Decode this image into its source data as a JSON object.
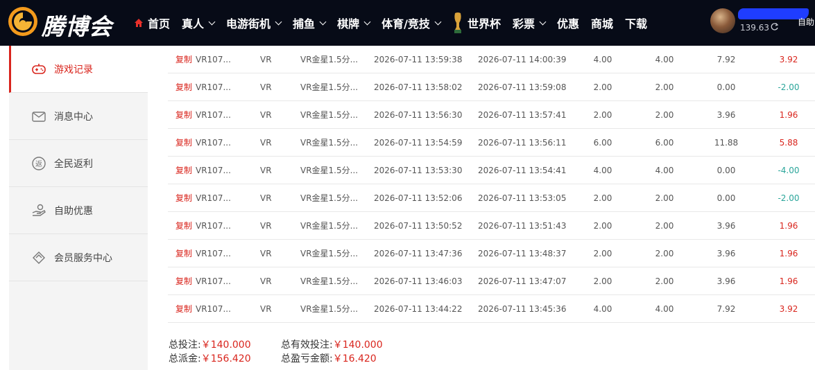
{
  "brand": {
    "name": "腾博会"
  },
  "nav": {
    "items": [
      {
        "label": "首页"
      },
      {
        "label": "真人"
      },
      {
        "label": "电游街机"
      },
      {
        "label": "捕鱼"
      },
      {
        "label": "棋牌"
      },
      {
        "label": "体育/竞技"
      },
      {
        "label": "世界杯"
      },
      {
        "label": "彩票"
      },
      {
        "label": "优惠"
      },
      {
        "label": "商城"
      },
      {
        "label": "下载"
      }
    ]
  },
  "user": {
    "balance": "139.63",
    "auto_label": "自助"
  },
  "sidebar": {
    "items": [
      {
        "label": "游戏记录",
        "icon": "gamepad-icon",
        "active": true
      },
      {
        "label": "消息中心",
        "icon": "mail-icon"
      },
      {
        "label": "全民返利",
        "icon": "rebate-icon"
      },
      {
        "label": "自助优惠",
        "icon": "hand-coin-icon"
      },
      {
        "label": "会员服务中心",
        "icon": "diamond-icon"
      }
    ]
  },
  "table": {
    "copy_label": "复制",
    "rows": [
      {
        "id": "VR107...",
        "platform": "VR",
        "game": "VR金星1.5分...",
        "bet_time": "2026-07-11 13:59:38",
        "settle_time": "2026-07-11 14:00:39",
        "bet": "4.00",
        "valid": "4.00",
        "payout": "7.92",
        "profit": "3.92",
        "sign": "pos"
      },
      {
        "id": "VR107...",
        "platform": "VR",
        "game": "VR金星1.5分...",
        "bet_time": "2026-07-11 13:58:02",
        "settle_time": "2026-07-11 13:59:08",
        "bet": "2.00",
        "valid": "2.00",
        "payout": "0.00",
        "profit": "-2.00",
        "sign": "neg"
      },
      {
        "id": "VR107...",
        "platform": "VR",
        "game": "VR金星1.5分...",
        "bet_time": "2026-07-11 13:56:30",
        "settle_time": "2026-07-11 13:57:41",
        "bet": "2.00",
        "valid": "2.00",
        "payout": "3.96",
        "profit": "1.96",
        "sign": "pos"
      },
      {
        "id": "VR107...",
        "platform": "VR",
        "game": "VR金星1.5分...",
        "bet_time": "2026-07-11 13:54:59",
        "settle_time": "2026-07-11 13:56:11",
        "bet": "6.00",
        "valid": "6.00",
        "payout": "11.88",
        "profit": "5.88",
        "sign": "pos"
      },
      {
        "id": "VR107...",
        "platform": "VR",
        "game": "VR金星1.5分...",
        "bet_time": "2026-07-11 13:53:30",
        "settle_time": "2026-07-11 13:54:41",
        "bet": "4.00",
        "valid": "4.00",
        "payout": "0.00",
        "profit": "-4.00",
        "sign": "neg"
      },
      {
        "id": "VR107...",
        "platform": "VR",
        "game": "VR金星1.5分...",
        "bet_time": "2026-07-11 13:52:06",
        "settle_time": "2026-07-11 13:53:05",
        "bet": "2.00",
        "valid": "2.00",
        "payout": "0.00",
        "profit": "-2.00",
        "sign": "neg"
      },
      {
        "id": "VR107...",
        "platform": "VR",
        "game": "VR金星1.5分...",
        "bet_time": "2026-07-11 13:50:52",
        "settle_time": "2026-07-11 13:51:43",
        "bet": "2.00",
        "valid": "2.00",
        "payout": "3.96",
        "profit": "1.96",
        "sign": "pos"
      },
      {
        "id": "VR107...",
        "platform": "VR",
        "game": "VR金星1.5分...",
        "bet_time": "2026-07-11 13:47:36",
        "settle_time": "2026-07-11 13:48:37",
        "bet": "2.00",
        "valid": "2.00",
        "payout": "3.96",
        "profit": "1.96",
        "sign": "pos"
      },
      {
        "id": "VR107...",
        "platform": "VR",
        "game": "VR金星1.5分...",
        "bet_time": "2026-07-11 13:46:03",
        "settle_time": "2026-07-11 13:47:07",
        "bet": "2.00",
        "valid": "2.00",
        "payout": "3.96",
        "profit": "1.96",
        "sign": "pos"
      },
      {
        "id": "VR107...",
        "platform": "VR",
        "game": "VR金星1.5分...",
        "bet_time": "2026-07-11 13:44:22",
        "settle_time": "2026-07-11 13:45:36",
        "bet": "4.00",
        "valid": "4.00",
        "payout": "7.92",
        "profit": "3.92",
        "sign": "pos"
      }
    ]
  },
  "totals": {
    "total_bet_label": "总投注:",
    "total_bet": "￥140.000",
    "total_valid_label": "总有效投注:",
    "total_valid": "￥140.000",
    "total_payout_label": "总派金:",
    "total_payout": "￥156.420",
    "total_profit_label": "总盈亏金额:",
    "total_profit": "￥16.420"
  },
  "colors": {
    "accent": "#d9251d",
    "negative": "#2aa59a",
    "nav_bg": "#070b17",
    "logo_orange": "#f39a1c"
  }
}
